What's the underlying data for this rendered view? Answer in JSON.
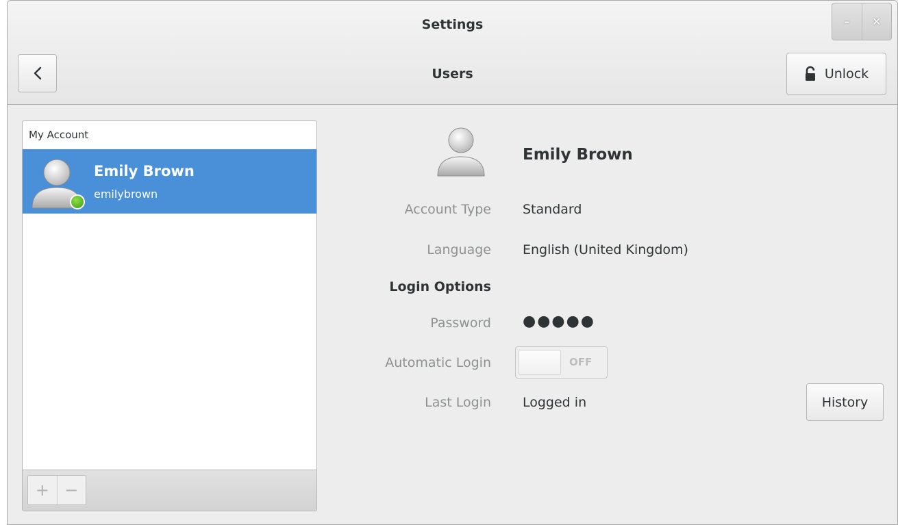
{
  "window": {
    "title": "Settings",
    "minimize_glyph": "–",
    "close_glyph": "✕"
  },
  "header": {
    "title": "Users",
    "back_glyph": "‹",
    "unlock_label": "Unlock",
    "unlock_icon": "padlock-icon"
  },
  "sidebar": {
    "heading": "My Account",
    "users": [
      {
        "name": "Emily Brown",
        "login": "emilybrown",
        "status": "online",
        "selected": true
      }
    ],
    "add_glyph": "+",
    "remove_glyph": "−"
  },
  "details": {
    "name": "Emily Brown",
    "account_type_label": "Account Type",
    "account_type_value": "Standard",
    "language_label": "Language",
    "language_value": "English (United Kingdom)",
    "login_options_label": "Login Options",
    "password_label": "Password",
    "password_value": "●●●●●",
    "auto_login_label": "Automatic Login",
    "auto_login_state": "OFF",
    "last_login_label": "Last Login",
    "last_login_value": "Logged in",
    "history_label": "History"
  },
  "colors": {
    "selection": "#4a90d9",
    "online": "#4caf1f",
    "label_gray": "#8e9192"
  }
}
